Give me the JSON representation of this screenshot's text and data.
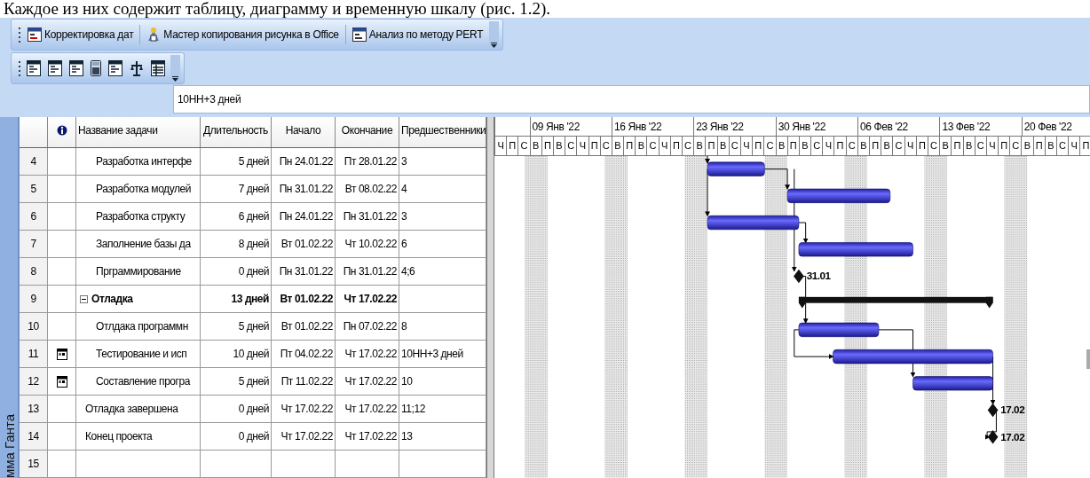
{
  "document_text": "Каждое из них содержит таблицу, диаграмму и временную шкалу (рис. 1.2).",
  "toolbar": {
    "buttons": [
      {
        "label": "Корректировка дат"
      },
      {
        "label": "Мастер копирования рисунка в Office"
      },
      {
        "label": "Анализ по методу PERT"
      }
    ]
  },
  "entry_bar": {
    "value": "10НН+3 дней"
  },
  "view_bar": {
    "label": "мма Ганта"
  },
  "table": {
    "columns": [
      "Название задачи",
      "Длительность",
      "Начало",
      "Окончание",
      "Предшественники"
    ],
    "rows": [
      {
        "id": "4",
        "kind": "subtask",
        "name": "Разработка интерфе",
        "duration": "5 дней",
        "start": "Пн 24.01.22",
        "finish": "Пт 28.01.22",
        "predecessors": "3",
        "indicator": false,
        "bar": {
          "kind": "task"
        }
      },
      {
        "id": "5",
        "kind": "subtask",
        "name": "Разработка модулей",
        "duration": "7 дней",
        "start": "Пн 31.01.22",
        "finish": "Вт 08.02.22",
        "predecessors": "4",
        "indicator": false,
        "bar": {
          "kind": "task"
        }
      },
      {
        "id": "6",
        "kind": "subtask",
        "name": "Разработка структу",
        "duration": "6 дней",
        "start": "Пн 24.01.22",
        "finish": "Пн 31.01.22",
        "predecessors": "3",
        "indicator": false,
        "bar": {
          "kind": "task"
        }
      },
      {
        "id": "7",
        "kind": "subtask",
        "name": "Заполнение базы да",
        "duration": "8 дней",
        "start": "Вт 01.02.22",
        "finish": "Чт 10.02.22",
        "predecessors": "6",
        "indicator": false,
        "bar": {
          "kind": "task"
        }
      },
      {
        "id": "8",
        "kind": "subtask",
        "name": "Прграммирование",
        "duration": "0 дней",
        "start": "Пн 31.01.22",
        "finish": "Пн 31.01.22",
        "predecessors": "4;6",
        "indicator": false,
        "bar": {
          "kind": "milestone",
          "label": "31.01"
        }
      },
      {
        "id": "9",
        "kind": "summary",
        "expanded": true,
        "name": "Отладка",
        "duration": "13 дней",
        "start": "Вт 01.02.22",
        "finish": "Чт 17.02.22",
        "indicator": false,
        "bar": {
          "kind": "summary"
        },
        "children": [
          {
            "id": "10",
            "kind": "subtask",
            "name": "Отлдака программн",
            "duration": "5 дней",
            "start": "Вт 01.02.22",
            "finish": "Пн 07.02.22",
            "predecessors": "8",
            "indicator": false,
            "bar": {
              "kind": "task"
            }
          },
          {
            "id": "11",
            "kind": "subtask",
            "name": "Тестирование и исп",
            "duration": "10 дней",
            "start": "Пт 04.02.22",
            "finish": "Чт 17.02.22",
            "predecessors": "10НН+3 дней",
            "indicator": true,
            "bar": {
              "kind": "task"
            }
          },
          {
            "id": "12",
            "kind": "subtask",
            "name": "Составление програ",
            "duration": "5 дней",
            "start": "Пт 11.02.22",
            "finish": "Чт 17.02.22",
            "predecessors": "10",
            "indicator": true,
            "bar": {
              "kind": "task"
            }
          }
        ]
      },
      {
        "id": "13",
        "kind": "task",
        "name": "Отладка завершена",
        "duration": "0 дней",
        "start": "Чт 17.02.22",
        "finish": "Чт 17.02.22",
        "predecessors": "11;12",
        "indicator": false,
        "bar": {
          "kind": "milestone",
          "label": "17.02"
        }
      },
      {
        "id": "14",
        "kind": "task",
        "name": "Конец проекта",
        "duration": "0 дней",
        "start": "Чт 17.02.22",
        "finish": "Чт 17.02.22",
        "predecessors": "13",
        "indicator": false,
        "bar": {
          "kind": "milestone",
          "label": "17.02"
        }
      },
      {
        "id": "15",
        "kind": "blank",
        "indicator": false
      }
    ]
  },
  "timescale": {
    "weeks": [
      "09 Янв '22",
      "16 Янв '22",
      "23 Янв '22",
      "30 Янв '22",
      "06 Фев '22",
      "13 Фев '22",
      "20 Фев '22"
    ],
    "days": [
      "Ч",
      "П",
      "С",
      "В",
      "П",
      "В",
      "С",
      "Ч",
      "П",
      "С",
      "В",
      "П",
      "В",
      "С",
      "Ч",
      "П",
      "С",
      "В",
      "П",
      "В",
      "С",
      "Ч",
      "П",
      "С",
      "В",
      "П",
      "В",
      "С",
      "Ч",
      "П",
      "С",
      "В",
      "П",
      "В",
      "С",
      "Ч",
      "П",
      "С",
      "В",
      "П",
      "В",
      "С",
      "Ч",
      "П",
      "С",
      "В",
      "П",
      "В",
      "С",
      "Ч",
      "П"
    ]
  }
}
